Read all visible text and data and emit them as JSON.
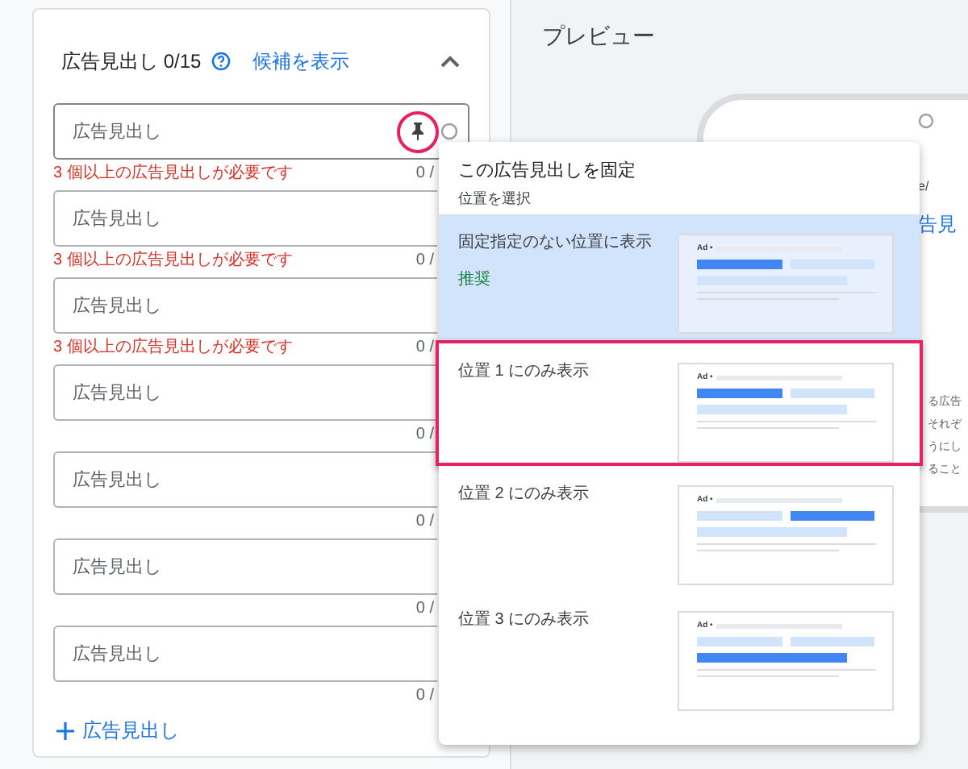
{
  "header": {
    "title": "広告見出し 0/15",
    "suggest_link": "候補を表示",
    "expanded": true
  },
  "fields": [
    {
      "placeholder": "広告見出し",
      "counter": "0 /",
      "error": "3 個以上の広告見出しが必要です",
      "focused": true
    },
    {
      "placeholder": "広告見出し",
      "counter": "0 /",
      "error": "3 個以上の広告見出しが必要です",
      "focused": false
    },
    {
      "placeholder": "広告見出し",
      "counter": "0 /",
      "error": "3 個以上の広告見出しが必要です",
      "focused": false
    },
    {
      "placeholder": "広告見出し",
      "counter": "0 /",
      "focused": false
    },
    {
      "placeholder": "広告見出し",
      "counter": "0 /",
      "focused": false
    },
    {
      "placeholder": "広告見出し",
      "counter": "0 /",
      "focused": false
    },
    {
      "placeholder": "広告見出し",
      "counter": "0 /",
      "focused": false
    }
  ],
  "add_button": "広告見出し",
  "preview": {
    "title": "プレビュー",
    "url_fragment": "e/",
    "headline_fragment": "告見",
    "description_fragments": [
      "る広告",
      "それぞ",
      "うにし",
      "ること"
    ]
  },
  "pin_menu": {
    "title": "この広告見出しを固定",
    "subtitle": "位置を選択",
    "options": [
      {
        "label": "固定指定のない位置に表示",
        "badge": "推奨",
        "ad_label": "Ad •",
        "selected": true,
        "highlighted": false,
        "kind": "unpinned"
      },
      {
        "label": "位置 1 にのみ表示",
        "ad_label": "Ad •",
        "selected": false,
        "highlighted": true,
        "kind": "pos1"
      },
      {
        "label": "位置 2 にのみ表示",
        "ad_label": "Ad •",
        "selected": false,
        "highlighted": false,
        "kind": "pos2"
      },
      {
        "label": "位置 3 にのみ表示",
        "ad_label": "Ad •",
        "selected": false,
        "highlighted": false,
        "kind": "pos3"
      }
    ]
  }
}
